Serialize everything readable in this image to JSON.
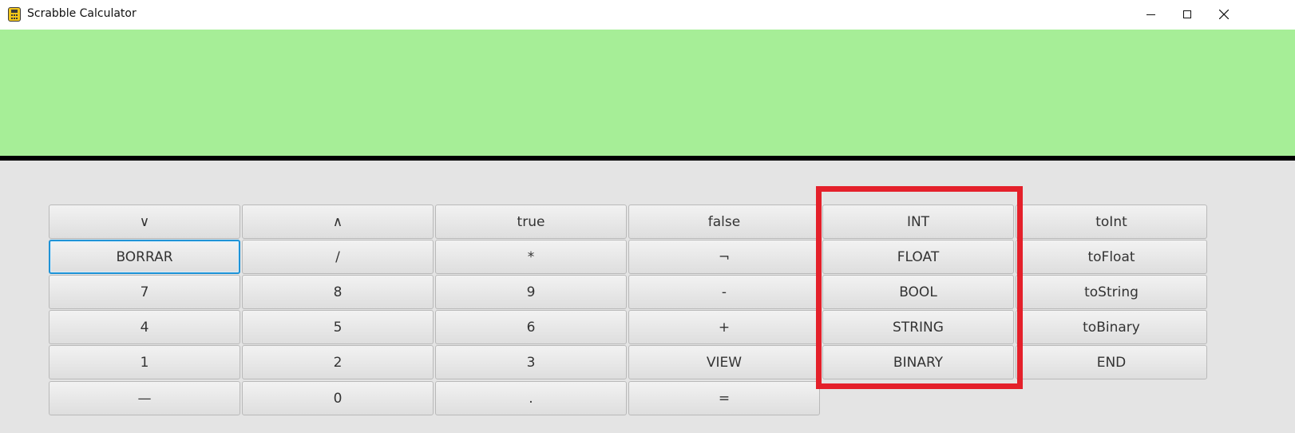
{
  "window": {
    "title": "Scrabble Calculator",
    "app_icon": "calculator-icon",
    "controls": [
      "minimize-icon",
      "maximize-icon",
      "close-icon"
    ]
  },
  "display": {
    "value": "",
    "background": "#a6ee97"
  },
  "keypad": {
    "rows": [
      [
        "∨",
        "∧",
        "true",
        "false",
        "INT",
        "toInt"
      ],
      [
        "BORRAR",
        "/",
        "*",
        "¬",
        "FLOAT",
        "toFloat"
      ],
      [
        "7",
        "8",
        "9",
        "-",
        "BOOL",
        "toString"
      ],
      [
        "4",
        "5",
        "6",
        "+",
        "STRING",
        "toBinary"
      ],
      [
        "1",
        "2",
        "3",
        "VIEW",
        "BINARY",
        "END"
      ],
      [
        "—",
        "0",
        ".",
        "="
      ]
    ],
    "focused_key": "BORRAR",
    "focus_color": "#1f93d6"
  },
  "annotation": {
    "color": "#e4202a"
  }
}
